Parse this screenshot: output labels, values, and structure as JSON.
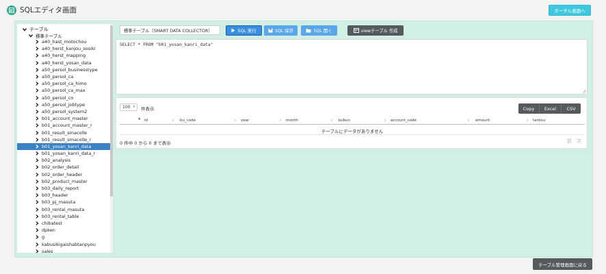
{
  "app": {
    "title": "SQLエディタ画面",
    "icon": "table-grid-icon"
  },
  "header": {
    "portal_button": "ポータル画面へ"
  },
  "tree": {
    "root_label": "テーブル",
    "group_label": "標準テーブル",
    "items": [
      "a40_hast_motochou",
      "a40_herst_kanjou_sosiki",
      "a40_herst_mapping",
      "a40_herst_yosan_data",
      "a50_persol_businesstype",
      "a50_persol_ca",
      "a50_persol_ca_himo",
      "a50_persol_ca_max",
      "a50_persol_co",
      "a50_persol_jobtype",
      "a50_persol_system2",
      "b01_account_master",
      "b01_account_master_r",
      "b01_result_smacolle",
      "b01_result_smacolle_r",
      "b01_yosan_kanri_data",
      "b01_yosan_kanri_data_r",
      "b02_analysis",
      "b02_order_detail",
      "b02_order_header",
      "b02_product_master",
      "b03_daily_report",
      "b03_header",
      "b03_pj_masuta",
      "b03_rental_masuta",
      "b03_rental_table",
      "chibatest",
      "dpken",
      "g",
      "kabusikigaishabtanpyou",
      "sales"
    ],
    "selected_item": "b01_yosan_kanri_data"
  },
  "toolbar": {
    "table_select_value": "標準テーブル（SMART DATA COLLECTOR）",
    "run_label": "SQL 実行",
    "save_label": "SQL 保存",
    "open_label": "SQL 開く",
    "view_label": "viewテーブル 作成"
  },
  "editor": {
    "sql": "SELECT * FROM \"b01_yosan_kanri_data\""
  },
  "results": {
    "page_length": "100",
    "page_length_label": "件表示",
    "export": {
      "copy": "Copy",
      "excel": "Excel",
      "csv": "CSV"
    },
    "columns": [
      "id",
      "bu_code",
      "year",
      "month",
      "kubun",
      "account_code",
      "amount",
      "tantou"
    ],
    "empty_message": "テーブルにデータがありません",
    "info": "0 件中 0 から 0 まで表示",
    "prev_label": "前",
    "next_label": "次"
  },
  "footer": {
    "back_button": "テーブル管理画面に戻る"
  },
  "colors": {
    "accent": "#3a8ee0",
    "panel_bg": "#d2efe5",
    "portal_button": "#3fc7df",
    "selected_row": "#3a82c5",
    "dark_button": "#555a5f",
    "app_icon": "#2eab8e"
  }
}
